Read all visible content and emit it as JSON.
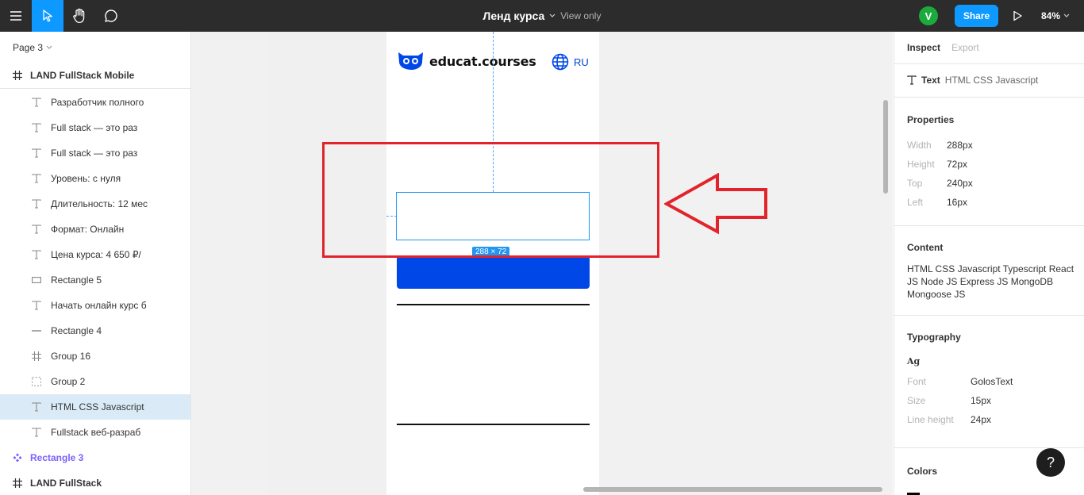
{
  "toolbar": {
    "title": "Ленд курса",
    "mode": "View only",
    "avatar_initial": "V",
    "share_label": "Share",
    "zoom": "84%"
  },
  "left_panel": {
    "page": "Page 3",
    "frame": "LAND FullStack Mobile",
    "layers": [
      {
        "label": "Разработчик полного",
        "icon": "text-icon"
      },
      {
        "label": "Full stack — это раз",
        "icon": "text-icon"
      },
      {
        "label": "Full stack — это раз",
        "icon": "text-icon"
      },
      {
        "label": "Уровень: с нуля",
        "icon": "text-icon"
      },
      {
        "label": "Длительность: 12 мес",
        "icon": "text-icon"
      },
      {
        "label": "Формат: Онлайн",
        "icon": "text-icon"
      },
      {
        "label": "Цена курса: 4 650 ₽/",
        "icon": "text-icon"
      },
      {
        "label": "Rectangle 5",
        "icon": "rectangle-icon"
      },
      {
        "label": "Начать онлайн курс б",
        "icon": "text-icon"
      },
      {
        "label": "Rectangle 4",
        "icon": "line-icon"
      },
      {
        "label": "Group 16",
        "icon": "frame-icon"
      },
      {
        "label": "Group 2",
        "icon": "group-icon"
      },
      {
        "label": "HTML CSS Javascript",
        "icon": "text-icon",
        "selected": true
      },
      {
        "label": "Fullstack веб-разраб",
        "icon": "text-icon"
      }
    ],
    "component": "Rectangle 3",
    "frame2": "LAND FullStack"
  },
  "canvas": {
    "logo_text": "educat.courses",
    "lang": "RU",
    "dimension_label": "288 × 72"
  },
  "inspect": {
    "tab_inspect": "Inspect",
    "tab_export": "Export",
    "layer_kind": "Text",
    "layer_name": "HTML CSS Javascript",
    "properties_title": "Properties",
    "props": [
      {
        "label": "Width",
        "value": "288px"
      },
      {
        "label": "Height",
        "value": "72px"
      },
      {
        "label": "Top",
        "value": "240px"
      },
      {
        "label": "Left",
        "value": "16px"
      }
    ],
    "content_title": "Content",
    "content_text": "HTML CSS Javascript Typescript React JS Node JS Express JS MongoDB Mongoose JS",
    "typography_title": "Typography",
    "ag": "Ag",
    "typo": [
      {
        "label": "Font",
        "value": "GolosText"
      },
      {
        "label": "Size",
        "value": "15px"
      },
      {
        "label": "Line height",
        "value": "24px"
      }
    ],
    "colors_title": "Colors",
    "help": "?"
  }
}
